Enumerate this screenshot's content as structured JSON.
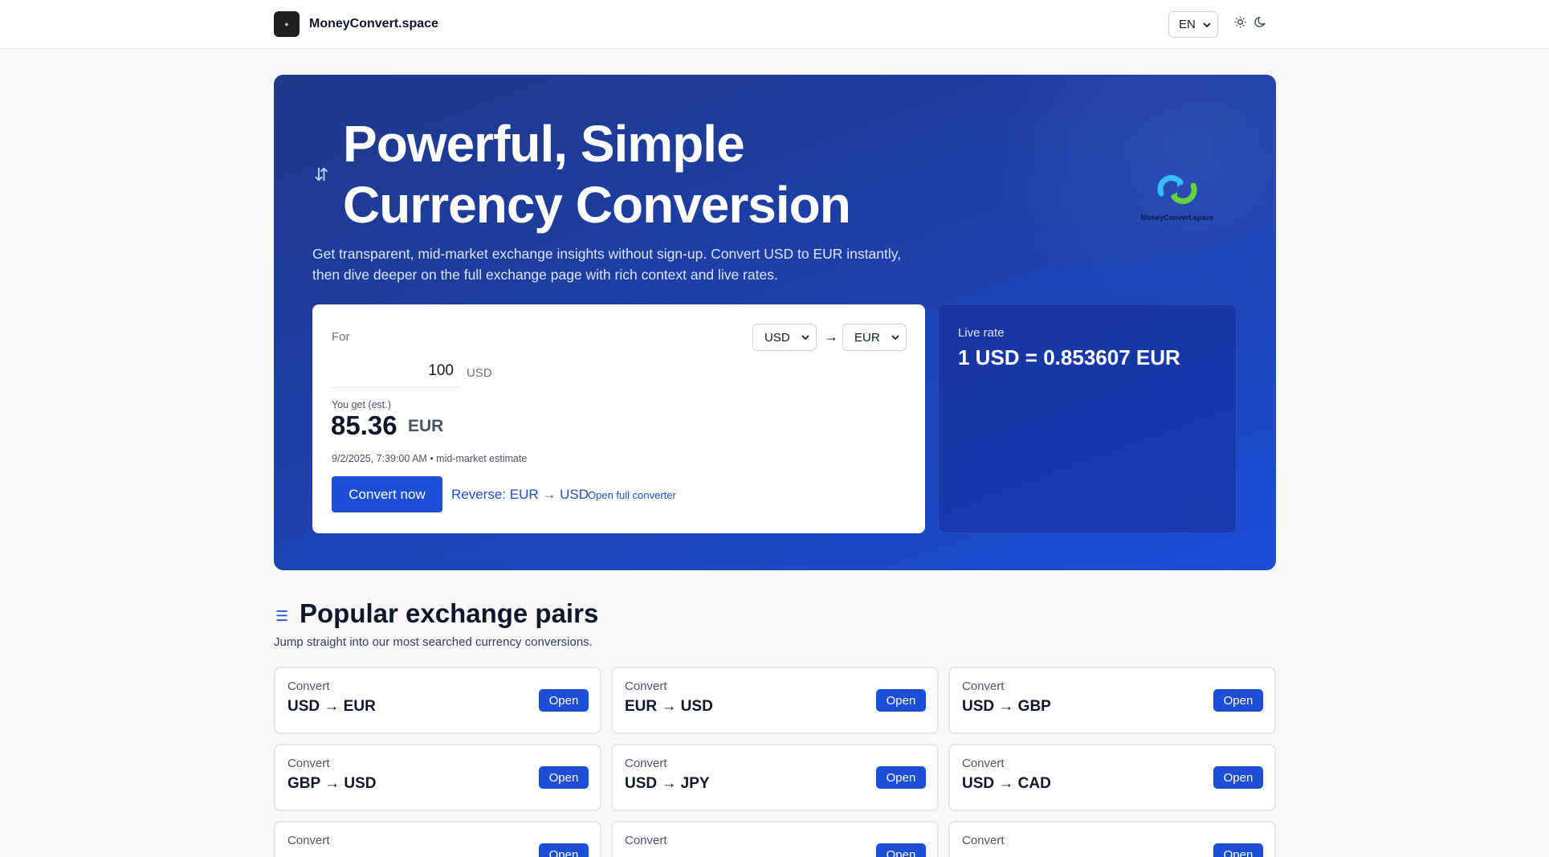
{
  "header": {
    "brand_name": "MoneyConvert.space",
    "language": "EN"
  },
  "hero": {
    "title_line1": "Powerful, Simple",
    "title_line2": "Currency Conversion",
    "description_line1": "Get transparent, mid-market exchange insights without sign-up. Convert USD to EUR instantly,",
    "description_line2": "then dive deeper on the full exchange page with rich context and live rates.",
    "logo_text": "MoneyConvert.space"
  },
  "converter": {
    "for_label": "For",
    "from_currency": "USD",
    "to_currency": "EUR",
    "amount": "100",
    "amount_unit": "USD",
    "you_get_label": "You get (est.)",
    "result_value": "85.36",
    "result_unit": "EUR",
    "meta": "9/2/2025, 7:39:00 AM • mid-market estimate",
    "convert_button": "Convert now",
    "reverse_link": "Reverse: EUR → USD",
    "full_link": "Open full converter"
  },
  "live_rate": {
    "label": "Live rate",
    "value": "1 USD = 0.853607 EUR"
  },
  "popular": {
    "title": "Popular exchange pairs",
    "subtitle": "Jump straight into our most searched currency conversions.",
    "convert_label": "Convert",
    "open_label": "Open",
    "pairs": [
      "USD → EUR",
      "EUR → USD",
      "USD → GBP",
      "GBP → USD",
      "USD → JPY",
      "USD → CAD",
      "",
      "",
      ""
    ]
  },
  "colors": {
    "accent": "#1d4ed8",
    "hero_start": "#1e3a8a",
    "hero_end": "#1d4ed8"
  }
}
